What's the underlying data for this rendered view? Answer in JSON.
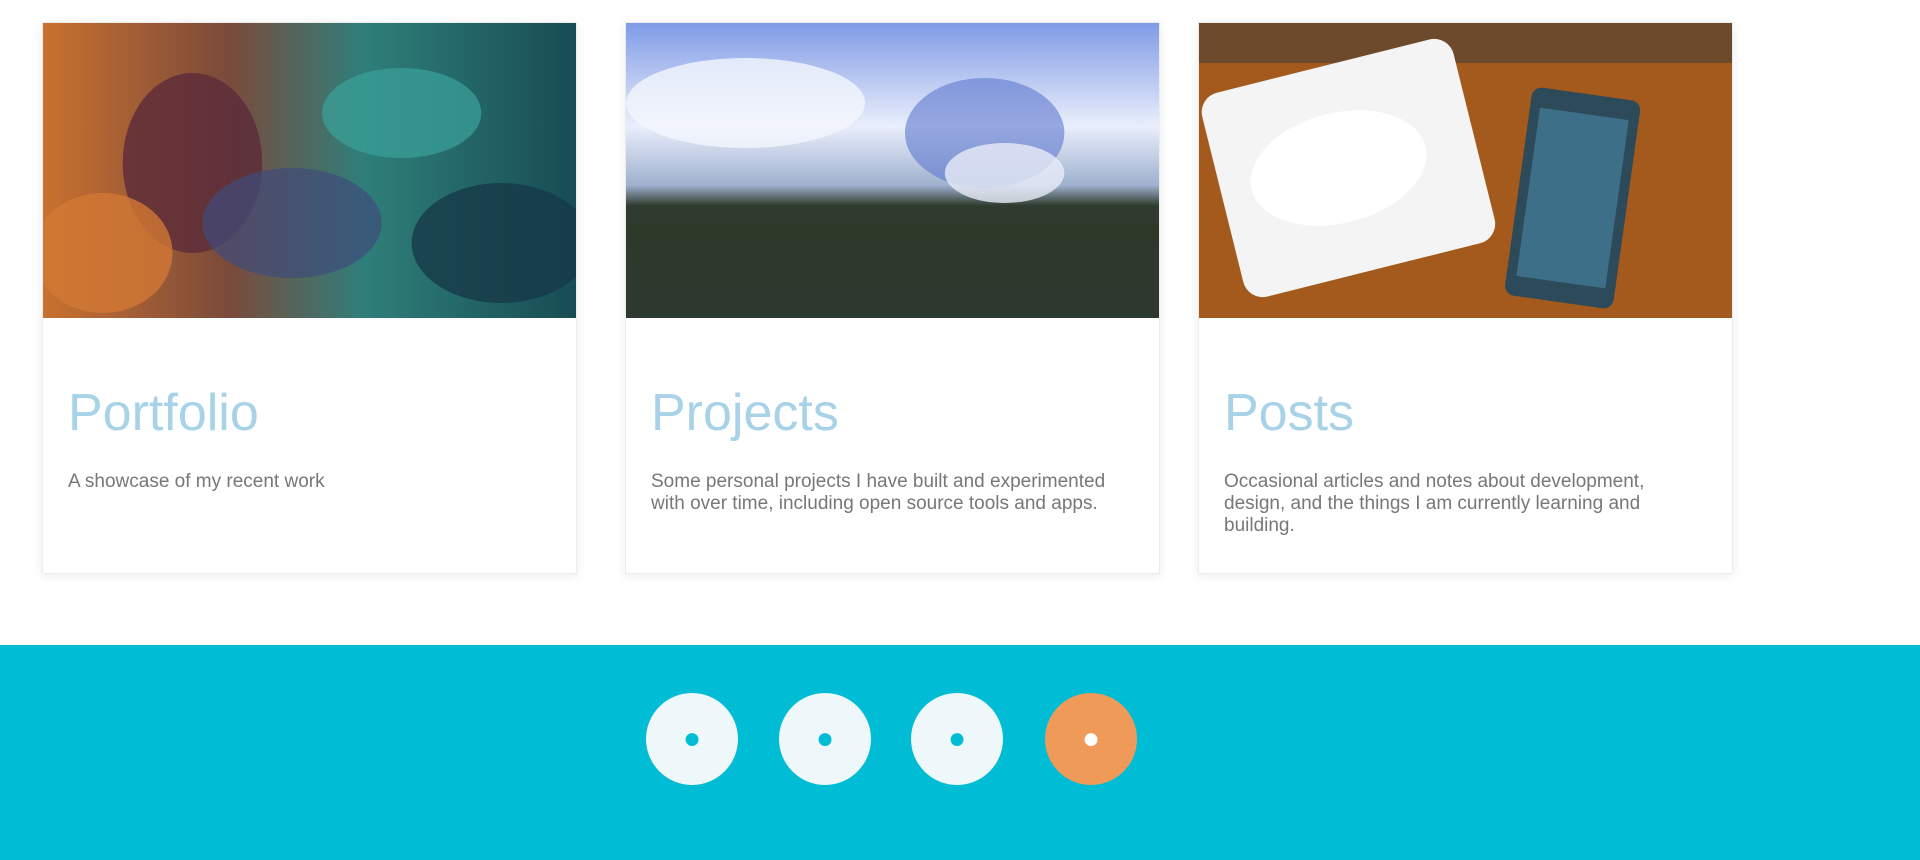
{
  "cards": [
    {
      "title": "Portfolio",
      "description": "A showcase of my recent work",
      "image_icon": "portfolio-image"
    },
    {
      "title": "Projects",
      "description": "Some personal projects I have built and experimented with over time, including open source tools and apps.",
      "image_icon": "projects-image"
    },
    {
      "title": "Posts",
      "description": "Occasional articles and notes about development, design, and the things I am currently learning and building.",
      "image_icon": "posts-image"
    }
  ],
  "footer": {
    "background": "#00bcd4",
    "social": [
      {
        "icon": "social-icon-1",
        "glyph": "●",
        "color": "#eef7f9"
      },
      {
        "icon": "social-icon-2",
        "glyph": "●",
        "color": "#eef7f9"
      },
      {
        "icon": "social-icon-3",
        "glyph": "●",
        "color": "#eef7f9"
      },
      {
        "icon": "social-icon-4",
        "glyph": "●",
        "color": "#ef9a59"
      }
    ]
  },
  "colors": {
    "title": "#a8d2e7",
    "accent": "#ef9a59",
    "footer": "#00bcd4"
  }
}
